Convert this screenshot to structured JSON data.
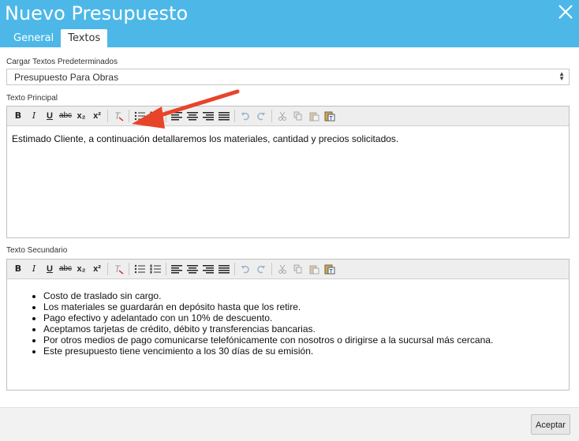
{
  "dialog": {
    "title": "Nuevo Presupuesto"
  },
  "tabs": [
    {
      "label": "General",
      "active": false
    },
    {
      "label": "Textos",
      "active": true
    }
  ],
  "defaults": {
    "label": "Cargar Textos Predeterminados",
    "selected": "Presupuesto Para Obras"
  },
  "main_text": {
    "label": "Texto Principal",
    "content": "Estimado Cliente, a continuación detallaremos los materiales, cantidad y precios solicitados."
  },
  "secondary_text": {
    "label": "Texto Secundario",
    "items": [
      "Costo de traslado sin cargo.",
      "Los materiales se guardarán en depósito hasta que los retire.",
      "Pago efectivo y adelantado con un 10% de descuento.",
      "Aceptamos tarjetas de crédito, débito y transferencias bancarias.",
      "Por otros medios de pago comunicarse telefónicamente con nosotros o dirigirse a la sucursal más cercana.",
      "Este presupuesto tiene vencimiento a los 30 días de su emisión."
    ]
  },
  "toolbar": {
    "bold": "B",
    "italic": "I",
    "underline": "U",
    "strike": "abc",
    "subscript": "x₂",
    "superscript": "x²"
  },
  "footer": {
    "accept_label": "Aceptar"
  },
  "colors": {
    "header": "#4db8e8",
    "arrow": "#e8442a"
  },
  "icons": [
    "close-icon",
    "remove-format-icon",
    "bullet-list-icon",
    "numbered-list-icon",
    "align-left-icon",
    "align-center-icon",
    "align-right-icon",
    "align-justify-icon",
    "undo-icon",
    "redo-icon",
    "cut-icon",
    "copy-icon",
    "paste-icon",
    "paste-text-icon",
    "select-arrows-icon",
    "annotation-arrow-icon"
  ]
}
